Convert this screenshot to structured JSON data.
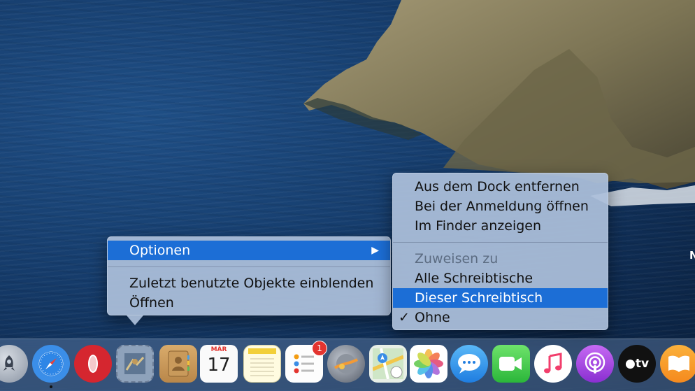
{
  "desktop": {
    "edge_text": "N"
  },
  "context_menu": {
    "items": [
      {
        "label": "Optionen",
        "state": "highlighted",
        "has_submenu": true,
        "arrow": "▶"
      },
      {
        "label": "Zuletzt benutzte Objekte einblenden"
      },
      {
        "label": "Öffnen"
      }
    ]
  },
  "options_submenu": {
    "items": [
      {
        "label": "Aus dem Dock entfernen"
      },
      {
        "label": "Bei der Anmeldung öffnen"
      },
      {
        "label": "Im Finder anzeigen"
      },
      {
        "label": "Zuweisen zu",
        "state": "disabled-header"
      },
      {
        "label": "Alle Schreibtische"
      },
      {
        "label": "Dieser Schreibtisch",
        "state": "highlighted"
      },
      {
        "label": "Ohne",
        "checked": true,
        "check_glyph": "✓"
      }
    ]
  },
  "dock": {
    "apps": [
      {
        "name": "launchpad",
        "icon": "rocket-icon"
      },
      {
        "name": "safari",
        "icon": "compass-icon",
        "running": true
      },
      {
        "name": "opera",
        "icon": "opera-o-icon"
      },
      {
        "name": "mail",
        "icon": "stamp-icon"
      },
      {
        "name": "contacts",
        "icon": "address-book-icon"
      },
      {
        "name": "calendar",
        "icon": "calendar-icon",
        "month": "MÄR",
        "day": "17"
      },
      {
        "name": "notes",
        "icon": "notepad-icon"
      },
      {
        "name": "reminders",
        "icon": "checklist-icon",
        "badge": "1"
      },
      {
        "name": "photo-app",
        "icon": "planet-icon"
      },
      {
        "name": "maps",
        "icon": "map-icon"
      },
      {
        "name": "photos",
        "icon": "flower-icon"
      },
      {
        "name": "messages",
        "icon": "speech-bubble-icon"
      },
      {
        "name": "facetime",
        "icon": "video-camera-icon"
      },
      {
        "name": "music",
        "icon": "music-note-icon"
      },
      {
        "name": "podcasts",
        "icon": "podcast-icon"
      },
      {
        "name": "apple-tv",
        "icon": "tv-icon",
        "label": "tv"
      },
      {
        "name": "books",
        "icon": "open-book-icon"
      }
    ]
  },
  "colors": {
    "highlight": "#1c6ed6",
    "menu_bg": "#acc0da",
    "badge": "#e3342f"
  }
}
